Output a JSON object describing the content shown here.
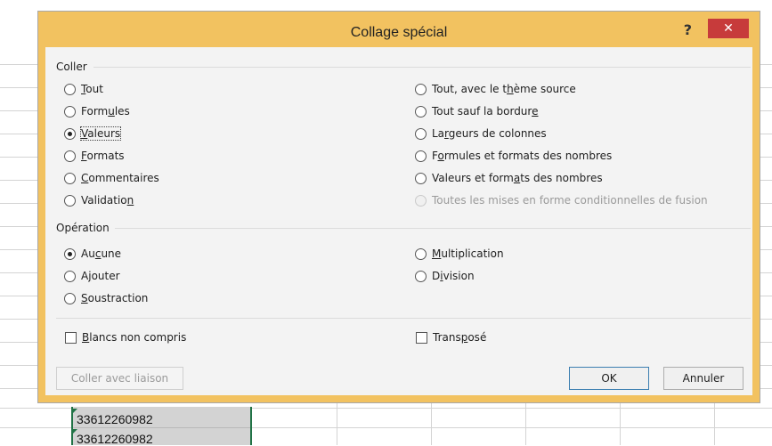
{
  "dialog": {
    "title": "Collage spécial",
    "help_label": "?",
    "close_label": "✕"
  },
  "paste_group": {
    "label": "Coller",
    "left_options": [
      {
        "before": "",
        "key": "T",
        "after": "out",
        "checked": false
      },
      {
        "before": "Form",
        "key": "u",
        "after": "les",
        "checked": false
      },
      {
        "before": "",
        "key": "V",
        "after": "aleurs",
        "checked": true
      },
      {
        "before": "",
        "key": "F",
        "after": "ormats",
        "checked": false
      },
      {
        "before": "",
        "key": "C",
        "after": "ommentaires",
        "checked": false
      },
      {
        "before": "Validatio",
        "key": "n",
        "after": "",
        "checked": false
      }
    ],
    "right_options": [
      {
        "before": "Tout, avec le t",
        "key": "h",
        "after": "ème source",
        "checked": false,
        "disabled": false
      },
      {
        "before": "Tout sauf la bordur",
        "key": "e",
        "after": "",
        "checked": false,
        "disabled": false
      },
      {
        "before": "La",
        "key": "r",
        "after": "geurs de colonnes",
        "checked": false,
        "disabled": false
      },
      {
        "before": "F",
        "key": "o",
        "after": "rmules et formats des nombres",
        "checked": false,
        "disabled": false
      },
      {
        "before": "Valeurs et form",
        "key": "a",
        "after": "ts des nombres",
        "checked": false,
        "disabled": false
      },
      {
        "before": "Toutes les mises en forme conditionnelles de fusion",
        "key": "",
        "after": "",
        "checked": false,
        "disabled": true
      }
    ]
  },
  "operation_group": {
    "label": "Opération",
    "left_options": [
      {
        "before": "Au",
        "key": "c",
        "after": "une",
        "checked": true
      },
      {
        "before": "A",
        "key": "j",
        "after": "outer",
        "checked": false
      },
      {
        "before": "",
        "key": "S",
        "after": "oustraction",
        "checked": false
      }
    ],
    "right_options": [
      {
        "before": "",
        "key": "M",
        "after": "ultiplication",
        "checked": false
      },
      {
        "before": "D",
        "key": "i",
        "after": "vision",
        "checked": false
      }
    ]
  },
  "checkboxes": {
    "skip_blanks": {
      "before": "",
      "key": "B",
      "after": "lancs non compris",
      "checked": false
    },
    "transpose": {
      "before": "Trans",
      "key": "p",
      "after": "osé",
      "checked": false
    }
  },
  "buttons": {
    "paste_link": "Coller avec liaison",
    "ok": "OK",
    "cancel": "Annuler"
  },
  "sheet": {
    "cells": [
      "33612260982",
      "33612260982"
    ]
  },
  "colors": {
    "dialog_frame": "#f2c260",
    "close_button": "#c73b3b",
    "selection_border": "#217346"
  }
}
